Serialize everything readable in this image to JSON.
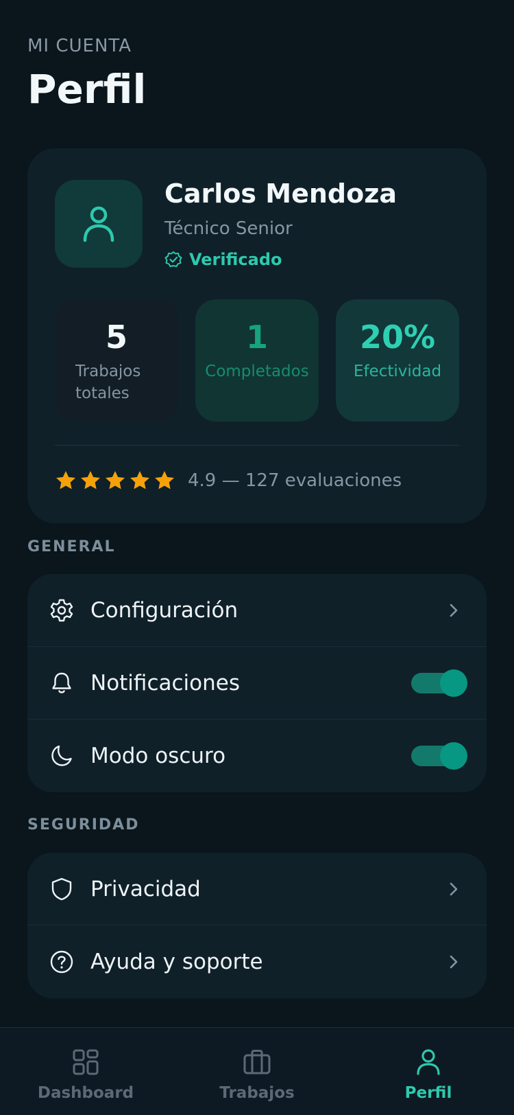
{
  "header": {
    "eyebrow": "MI CUENTA",
    "title": "Perfil"
  },
  "profile": {
    "name": "Carlos Mendoza",
    "role": "Técnico Senior",
    "verified_label": "Verificado",
    "stats": [
      {
        "value": "5",
        "label": "Trabajos totales"
      },
      {
        "value": "1",
        "label": "Completados"
      },
      {
        "value": "20%",
        "label": "Efectividad"
      }
    ],
    "rating": {
      "stars": 5,
      "text": "4.9 — 127 evaluaciones"
    }
  },
  "general": {
    "label": "GENERAL",
    "items": [
      {
        "label": "Configuración",
        "icon": "gear-icon",
        "control": "chevron"
      },
      {
        "label": "Notificaciones",
        "icon": "bell-icon",
        "control": "toggle",
        "on": true
      },
      {
        "label": "Modo oscuro",
        "icon": "moon-icon",
        "control": "toggle",
        "on": true
      }
    ]
  },
  "security": {
    "label": "SEGURIDAD",
    "items": [
      {
        "label": "Privacidad",
        "icon": "shield-icon",
        "control": "chevron"
      },
      {
        "label": "Ayuda y soporte",
        "icon": "help-circle-icon",
        "control": "chevron"
      }
    ]
  },
  "tabbar": {
    "items": [
      {
        "label": "Dashboard",
        "icon": "grid-icon",
        "active": false
      },
      {
        "label": "Trabajos",
        "icon": "briefcase-icon",
        "active": false
      },
      {
        "label": "Perfil",
        "icon": "user-icon",
        "active": true
      }
    ]
  },
  "colors": {
    "accent": "#2ec9ad",
    "background": "#0a151c",
    "card": "#0f2029",
    "star": "#f5a20a"
  }
}
